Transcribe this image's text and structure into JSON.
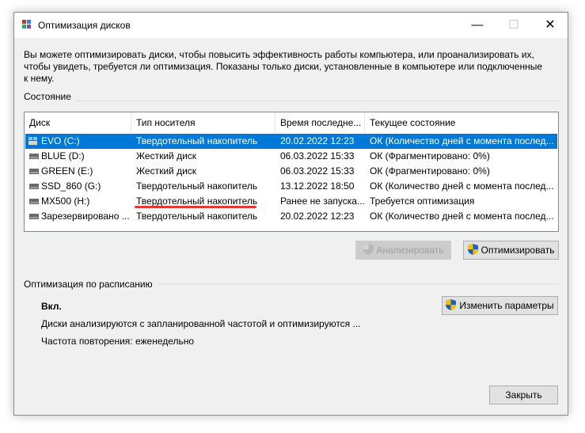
{
  "window": {
    "title": "Оптимизация дисков",
    "controls": {
      "minimize": "—",
      "maximize": "☐",
      "close": "✕"
    }
  },
  "description": "Вы можете оптимизировать диски, чтобы повысить эффективность работы  компьютера, или проанализировать их, чтобы увидеть, требуется ли оптимизация. Показаны только диски, установленные в компьютере или подключенные к нему.",
  "status_section": {
    "label": "Состояние",
    "columns": [
      "Диск",
      "Тип носителя",
      "Время последне...",
      "Текущее состояние"
    ],
    "rows": [
      {
        "disk": "EVO (C:)",
        "media": "Твердотельный накопитель",
        "last": "20.02.2022 12:23",
        "state": "ОК (Количество дней с момента послед...",
        "icon": "windows-drive-icon",
        "selected": true
      },
      {
        "disk": "BLUE (D:)",
        "media": "Жесткий диск",
        "last": "06.03.2022 15:33",
        "state": "ОК (Фрагментировано: 0%)",
        "icon": "hard-drive-icon"
      },
      {
        "disk": "GREEN (E:)",
        "media": "Жесткий диск",
        "last": "06.03.2022 15:33",
        "state": "ОК (Фрагментировано: 0%)",
        "icon": "hard-drive-icon"
      },
      {
        "disk": "SSD_860 (G:)",
        "media": "Твердотельный накопитель",
        "last": "13.12.2022 18:50",
        "state": "ОК (Количество дней с момента послед...",
        "icon": "hard-drive-icon"
      },
      {
        "disk": "MX500 (H:)",
        "media": "Твердотельный накопитель",
        "last": "Ранее не запуска...",
        "state": "Требуется оптимизация",
        "icon": "hard-drive-icon"
      },
      {
        "disk": "Зарезервировано ...",
        "media": "Твердотельный накопитель",
        "last": "20.02.2022 12:23",
        "state": "ОК (Количество дней с момента послед...",
        "icon": "hard-drive-icon"
      }
    ],
    "analyze_button": "Анализировать",
    "optimize_button": "Оптимизировать"
  },
  "schedule_section": {
    "label": "Оптимизация по расписанию",
    "status": "Вкл.",
    "description": "Диски анализируются с запланированной частотой и оптимизируются ...",
    "frequency": "Частота повторения: еженедельно",
    "change_button": "Изменить параметры"
  },
  "close_button": "Закрыть",
  "colors": {
    "selection": "#0078d7",
    "annotation": "#e53935"
  }
}
